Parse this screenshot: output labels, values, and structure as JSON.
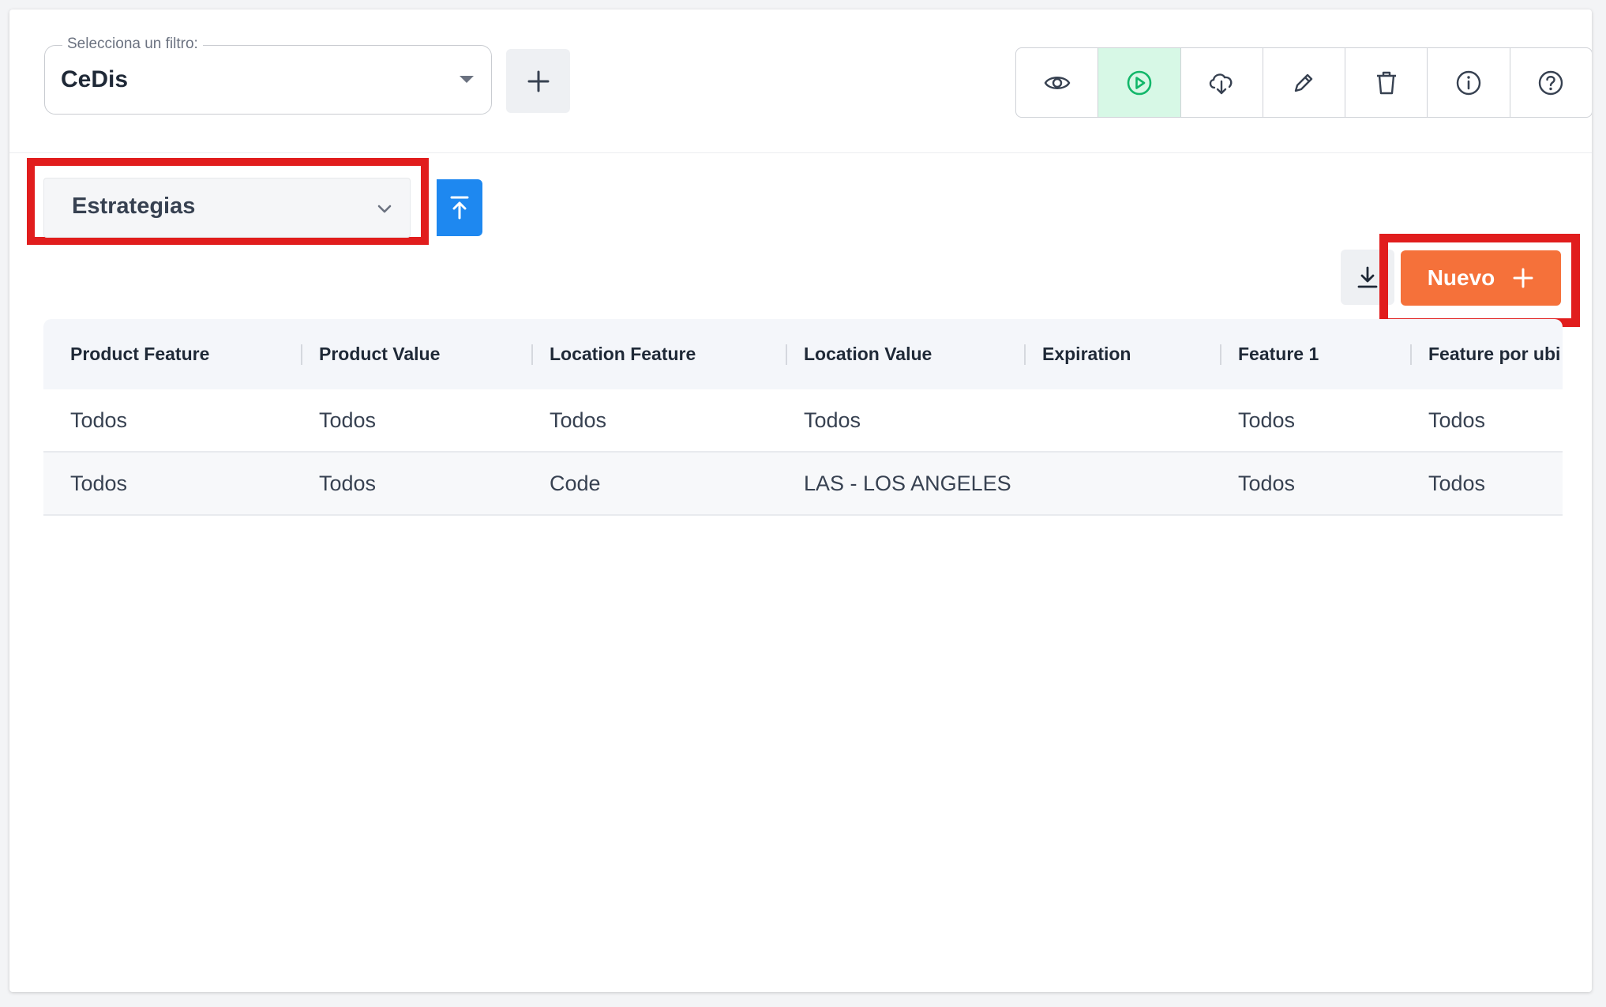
{
  "filter": {
    "legend": "Selecciona un filtro:",
    "value": "CeDis"
  },
  "toolbar": {
    "buttons": [
      {
        "icon": "eye-icon"
      },
      {
        "icon": "play-circle-icon",
        "active": true
      },
      {
        "icon": "cloud-download-icon"
      },
      {
        "icon": "pencil-icon"
      },
      {
        "icon": "trash-icon"
      },
      {
        "icon": "info-icon"
      },
      {
        "icon": "help-icon"
      }
    ]
  },
  "section": {
    "value": "Estrategias"
  },
  "actions": {
    "new_label": "Nuevo"
  },
  "table": {
    "columns": [
      "Product Feature",
      "Product Value",
      "Location Feature",
      "Location Value",
      "Expiration",
      "Feature 1",
      "Feature por ubi"
    ],
    "rows": [
      [
        "Todos",
        "Todos",
        "Todos",
        "Todos",
        "",
        "Todos",
        "Todos"
      ],
      [
        "Todos",
        "Todos",
        "Code",
        "LAS - LOS ANGELES",
        "",
        "Todos",
        "Todos"
      ]
    ]
  },
  "colors": {
    "accent_orange": "#f5713a",
    "accent_blue": "#1e88f0",
    "active_green": "#d7f8e6",
    "highlight_red": "#e11d1d"
  }
}
